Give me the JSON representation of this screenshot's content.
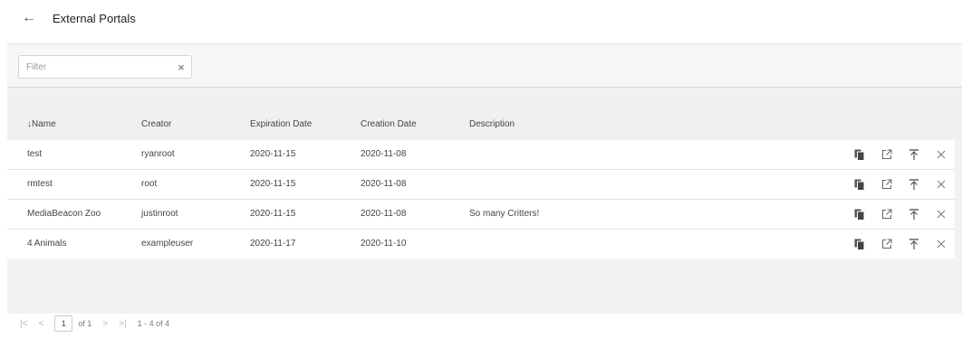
{
  "header": {
    "back_icon": "←",
    "title": "External Portals"
  },
  "filter": {
    "placeholder": "Filter",
    "value": "",
    "clear_icon": "×"
  },
  "columns": {
    "name": "↓Name",
    "creator": "Creator",
    "expiration": "Expiration Date",
    "creation": "Creation Date",
    "description": "Description"
  },
  "rows": [
    {
      "name": "test",
      "creator": "ryanroot",
      "expiration": "2020-11-15",
      "creation": "2020-11-08",
      "description": ""
    },
    {
      "name": "rmtest",
      "creator": "root",
      "expiration": "2020-11-15",
      "creation": "2020-11-08",
      "description": ""
    },
    {
      "name": "MediaBeacon Zoo",
      "creator": "justinroot",
      "expiration": "2020-11-15",
      "creation": "2020-11-08",
      "description": "So many Critters!"
    },
    {
      "name": "4 Animals",
      "creator": "exampleuser",
      "expiration": "2020-11-17",
      "creation": "2020-11-10",
      "description": ""
    }
  ],
  "row_actions": [
    "copy-icon",
    "open-external-icon",
    "download-icon",
    "delete-icon"
  ],
  "pager": {
    "first": "|<",
    "prev": "<",
    "page": "1",
    "of_pages": "of 1",
    "next": ">",
    "last": ">|",
    "range": "1 - 4 of 4"
  }
}
